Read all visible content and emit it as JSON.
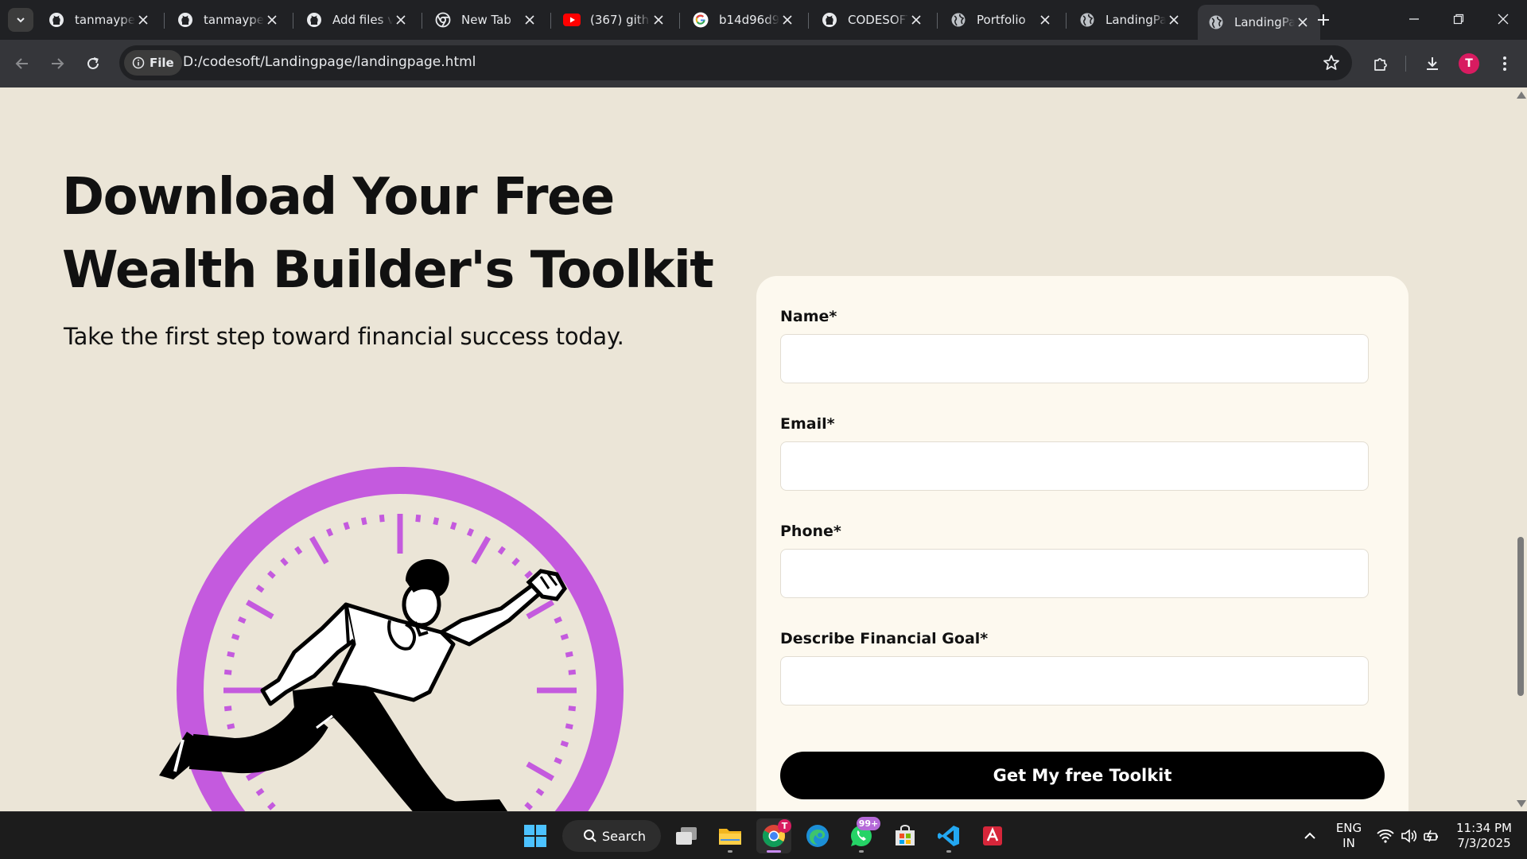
{
  "browser": {
    "tabs": [
      {
        "title": "tanmaypes",
        "favicon": "github-icon"
      },
      {
        "title": "tanmaypes",
        "favicon": "github-icon"
      },
      {
        "title": "Add files via",
        "favicon": "github-icon"
      },
      {
        "title": "New Tab",
        "favicon": "chrome-icon"
      },
      {
        "title": "(367) githu",
        "favicon": "youtube-icon"
      },
      {
        "title": "b14d96d9a",
        "favicon": "google-icon"
      },
      {
        "title": "CODESOFT",
        "favicon": "github-icon"
      },
      {
        "title": "Portfolio",
        "favicon": "globe-icon"
      },
      {
        "title": "LandingPa",
        "favicon": "globe-icon"
      },
      {
        "title": "LandingPa",
        "favicon": "globe-icon",
        "active": true
      }
    ],
    "scheme_chip": "File",
    "url": "D:/codesoft/Landingpage/landingpage.html",
    "profile_initial": "T"
  },
  "page": {
    "headline_line1": "Download Your Free",
    "headline_line2": "Wealth Builder's Toolkit",
    "subheadline": "Take the first step toward financial success today.",
    "illustration": "running-man-clock-illustration",
    "accent_color": "#c45ade",
    "form": {
      "fields": [
        {
          "label": "Name*",
          "value": ""
        },
        {
          "label": "Email*",
          "value": ""
        },
        {
          "label": "Phone*",
          "value": ""
        },
        {
          "label": "Describe Financial Goal*",
          "value": ""
        }
      ],
      "submit_label": "Get My free Toolkit"
    }
  },
  "taskbar": {
    "search_label": "Search",
    "whatsapp_badge": "99+",
    "chrome_badge": "T",
    "lang_line1": "ENG",
    "lang_line2": "IN",
    "time": "11:34 PM",
    "date": "7/3/2025"
  }
}
